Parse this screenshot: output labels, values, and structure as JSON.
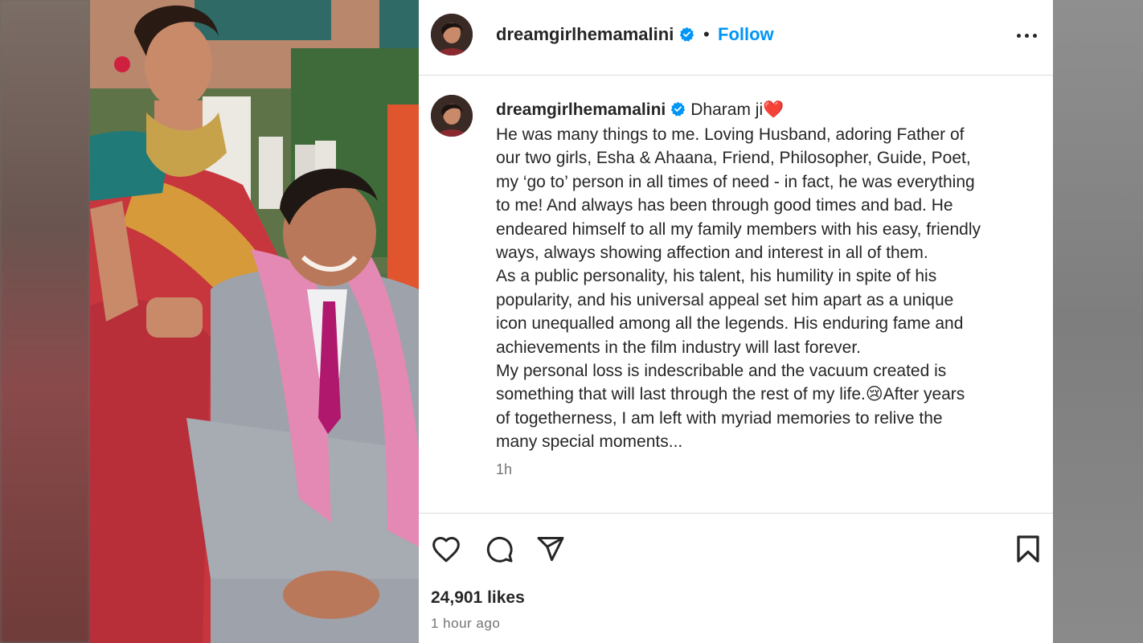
{
  "post": {
    "username": "dreamgirlhemamalini",
    "follow_label": "Follow",
    "separator": "•",
    "caption_title": "Dharam ji",
    "caption_title_emoji": "❤️",
    "caption_lines": [
      "He was many things to me. Loving Husband, adoring Father of",
      "our two girls, Esha & Ahaana, Friend, Philosopher, Guide, Poet,",
      "my ‘go to’ person in all times of need - in fact, he was everything",
      "to me! And always has been through good times and bad. He",
      "endeared himself to all my family members with his easy, friendly",
      "ways, always showing affection and interest in all of them.",
      "As a public personality, his talent, his humility in spite of his",
      "popularity, and his universal appeal set him apart as a unique",
      "icon unequalled among all the legends. His enduring fame and",
      "achievements in the film industry will last forever.",
      "My personal loss is indescribable and the vacuum created is",
      "something that will last through the rest of my life.😢After years",
      "of togetherness, I am left with myriad memories to relive the",
      "many special moments..."
    ],
    "caption_time": "1h",
    "likes": "24,901 likes",
    "time_ago": "1 hour ago"
  },
  "icons": {
    "verified": "verified-badge-icon",
    "more": "more-options-icon",
    "like": "heart-icon",
    "comment": "comment-icon",
    "share": "share-icon",
    "save": "bookmark-icon"
  },
  "colors": {
    "accent": "#0095f6",
    "text": "#262626",
    "muted": "#737373",
    "divider": "#dbdbdb",
    "heart": "#e0202c"
  }
}
